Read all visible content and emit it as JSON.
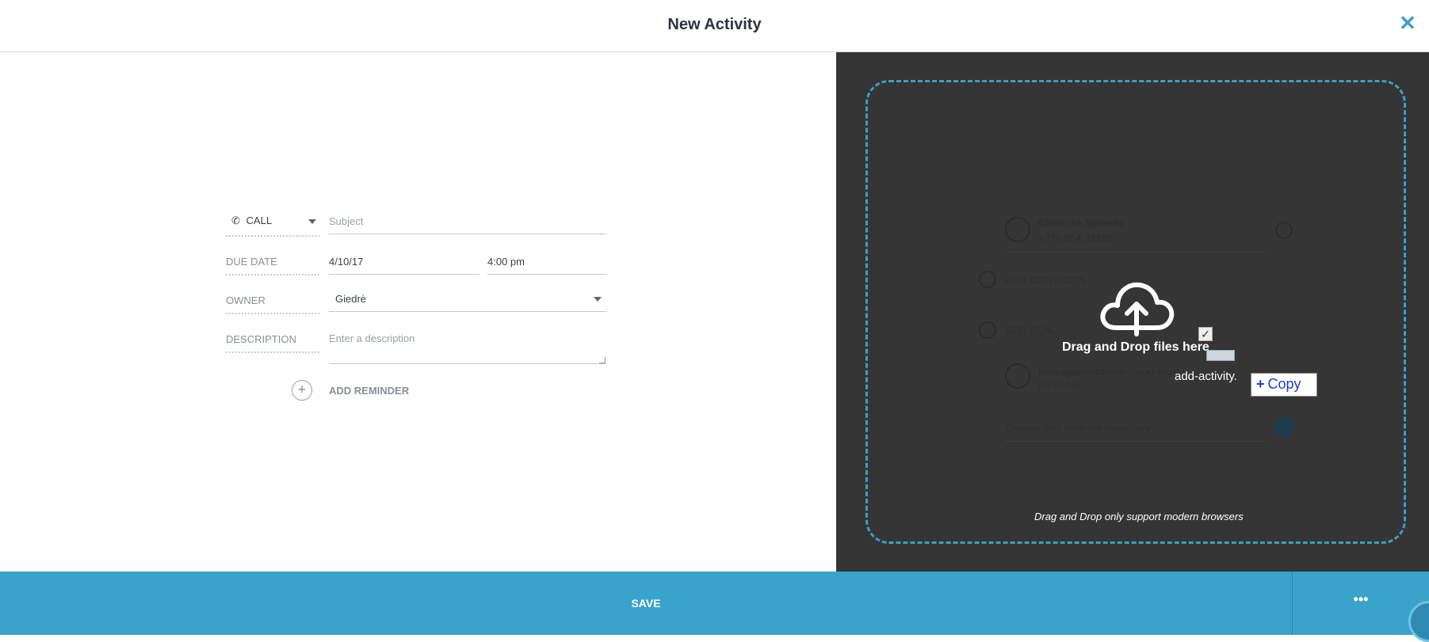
{
  "header": {
    "title": "New Activity",
    "close_icon": "close-icon"
  },
  "form": {
    "type": {
      "label": "CALL",
      "icon": "phone-icon"
    },
    "subject": {
      "placeholder": "Subject"
    },
    "due_date": {
      "label": "DUE DATE",
      "date": "4/10/17",
      "time": "4:00 pm"
    },
    "owner": {
      "label": "OWNER",
      "value": "Giedrė"
    },
    "description": {
      "label": "DESCRIPTION",
      "placeholder": "Enter a description"
    },
    "reminder": {
      "label": "ADD REMINDER"
    }
  },
  "dropzone": {
    "title": "Drag and Drop files here",
    "note": "Drag and Drop only support modern browsers",
    "behind": {
      "contact_name": "Charisse Spinello",
      "contact_phone": "+370 654 32109",
      "add_contacts": "ADD CONTACTS",
      "add_deal": "ADD DEAL",
      "file_name": "new-appointment-cloud-icon-link-file.png",
      "file_size": "(49.73 KB)",
      "repository_placeholder": "Choose files from the repository"
    }
  },
  "drag": {
    "file_label": "add-activity.",
    "copy_label": "Copy"
  },
  "footer": {
    "save_label": "SAVE",
    "more_label": "•••"
  },
  "colors": {
    "accent": "#3aa3cc",
    "panel": "#353535",
    "dash": "#3aa0c8"
  }
}
